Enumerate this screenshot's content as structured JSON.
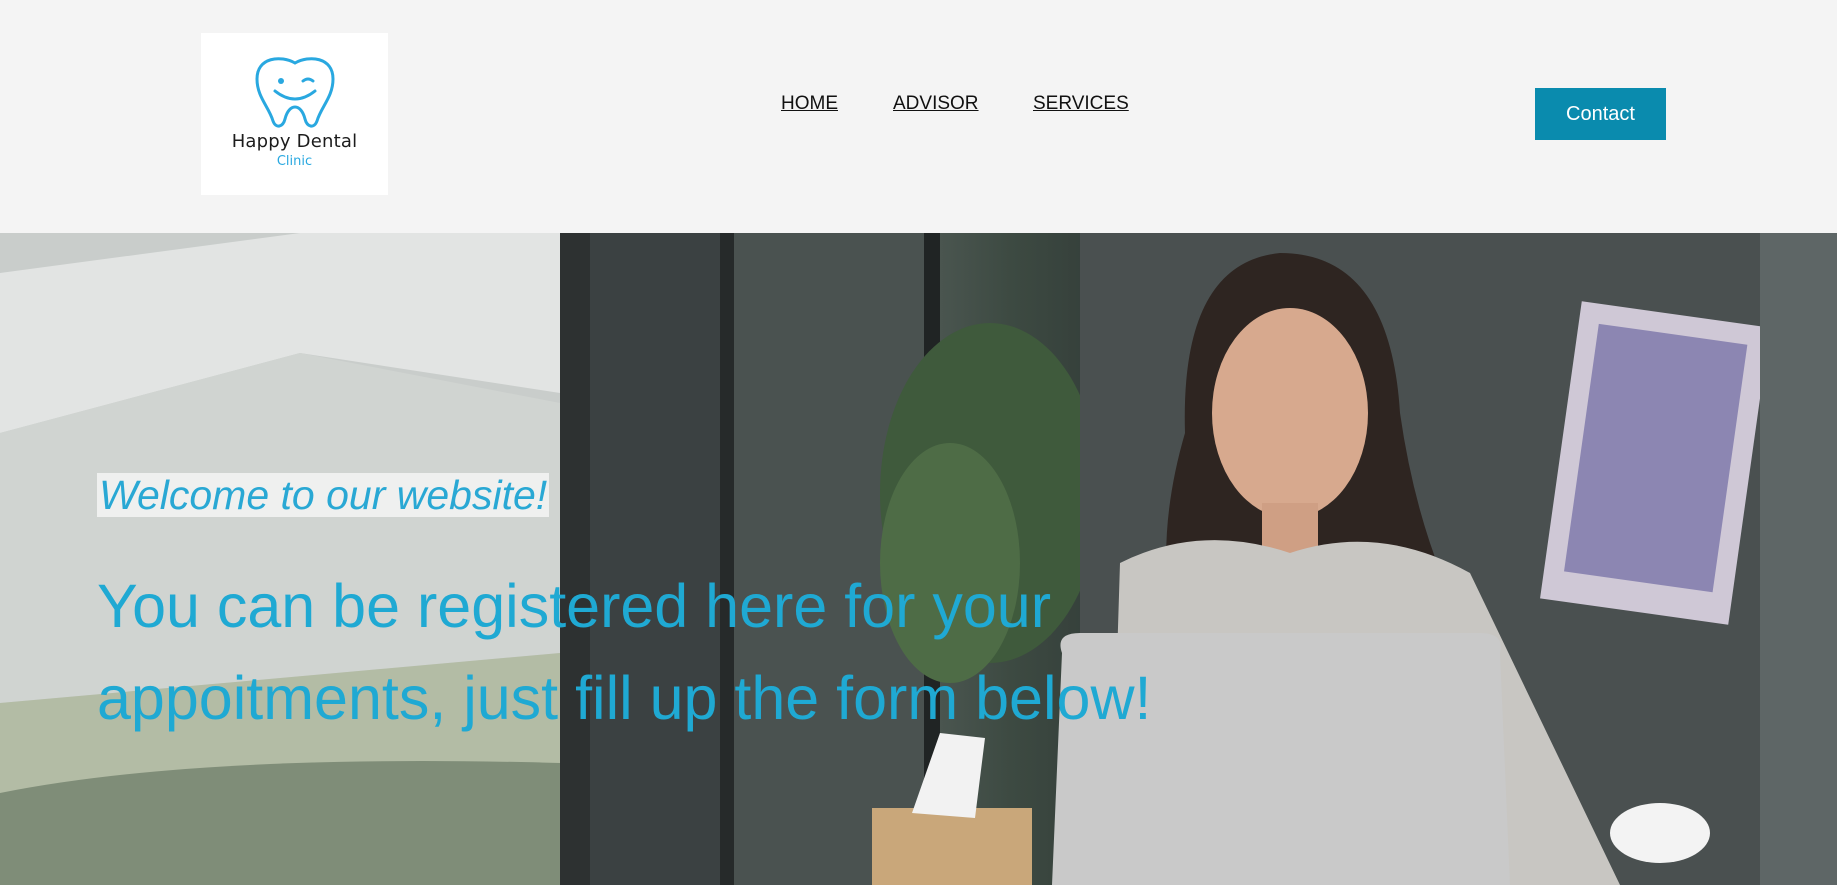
{
  "logo": {
    "title": "Happy Dental",
    "subtitle": "Clinic",
    "icon": "smiling-tooth-icon"
  },
  "nav": {
    "items": [
      {
        "label": "HOME"
      },
      {
        "label": "ADVISOR"
      },
      {
        "label": "SERVICES"
      }
    ]
  },
  "header": {
    "contact_label": "Contact"
  },
  "hero": {
    "welcome": "Welcome to our website!",
    "headline": "You can be registered here for your appoitments, just fill up the form below!"
  },
  "colors": {
    "accent": "#1fa9d3",
    "button": "#0a8bae",
    "header_bg": "#f4f4f4"
  }
}
